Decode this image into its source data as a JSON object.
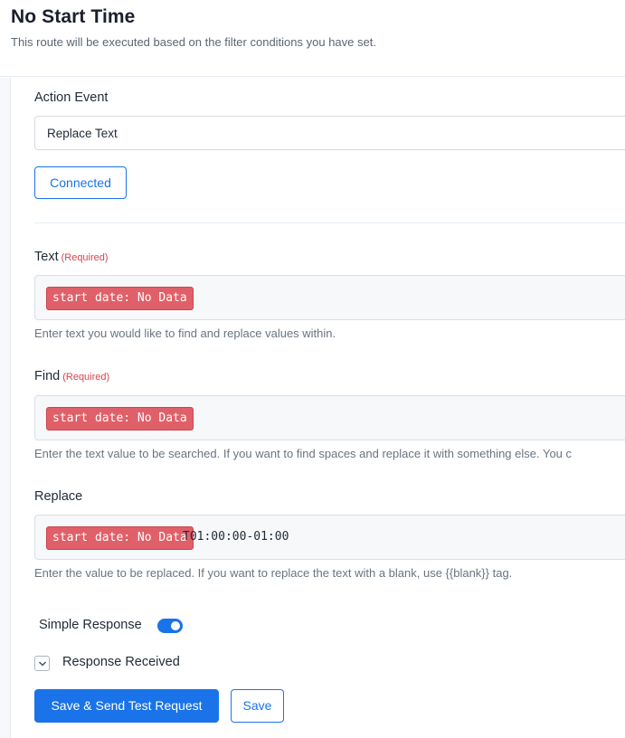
{
  "header": {
    "title": "No Start Time",
    "subtitle": "This route will be executed based on the filter conditions you have set."
  },
  "action_event": {
    "label": "Action Event",
    "selected_value": "Replace Text"
  },
  "connected_button": {
    "label": "Connected"
  },
  "fields": {
    "text": {
      "label": "Text",
      "required_tag": "(Required)",
      "chip": "start date: No Data",
      "help": "Enter text you would like to find and replace values within."
    },
    "find": {
      "label": "Find",
      "required_tag": "(Required)",
      "chip": "start date: No Data",
      "help": "Enter the text value to be searched. If you want to find spaces and replace it with something else. You c"
    },
    "replace": {
      "label": "Replace",
      "chip": "start date: No Data",
      "suffix": "T01:00:00-01:00",
      "help": "Enter the value to be replaced. If you want to replace the text with a blank, use {{blank}} tag."
    }
  },
  "simple_response": {
    "label": "Simple Response",
    "enabled": true
  },
  "response_received": {
    "label": "Response Received"
  },
  "footer": {
    "save_send_label": "Save & Send Test Request",
    "save_label": "Save"
  },
  "colors": {
    "accent": "#1a73e8",
    "chip_bg": "#e06069",
    "required": "#d6454f"
  }
}
